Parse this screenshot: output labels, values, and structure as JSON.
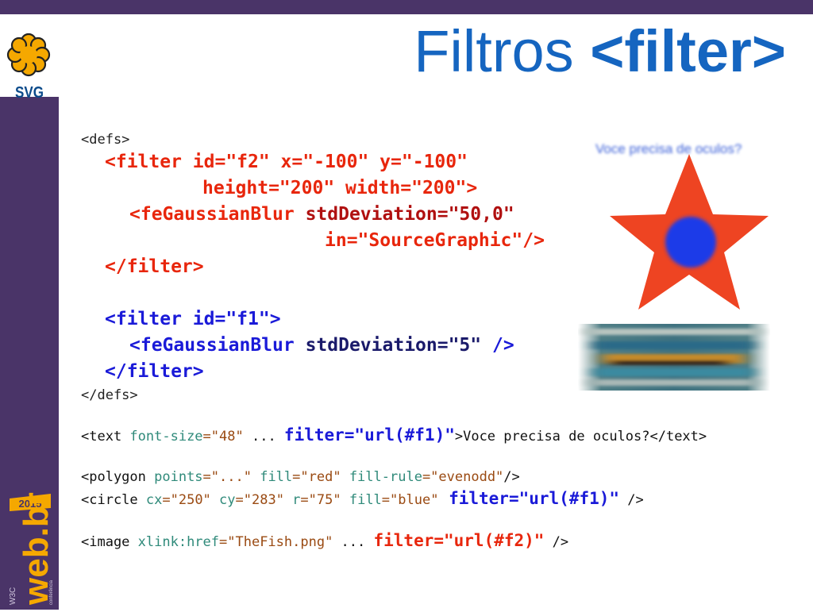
{
  "logo": {
    "icon": "svg-flower-icon",
    "text": "SVG"
  },
  "title": {
    "normal": "Filtros ",
    "bold": "<filter>"
  },
  "code": {
    "l1": "<defs>",
    "l2": "<filter id=\"f2\" x=\"-100\" y=\"-100\"",
    "l3": "height=\"200\" width=\"200\">",
    "l4a": "<feGaussianBlur",
    "l4b": " stdDeviation=\"50,0\"",
    "l5": "in=\"SourceGraphic\"/>",
    "l6": "</filter>",
    "l7a": "<filter id=\"f1\">",
    "l8a": "<feGaussianBlur",
    "l8b": " stdDeviation=\"5\"",
    "l8c": " />",
    "l9": "</filter>",
    "l10": "</defs>",
    "t1": "<text",
    "t2": " font-size",
    "t3": "=\"48\"",
    "t4": " ... ",
    "t5": "filter=\"url(#f1)\"",
    "t6": ">Voce precisa de oculos?</text>",
    "p1": "<polygon",
    "p2": " points",
    "p3": "=\"...\"",
    "p4": " fill",
    "p5": "=\"red\"",
    "p6": " fill-rule",
    "p7": "=\"evenodd\"",
    "p8": "/>",
    "c1": "<circle",
    "c2": " cx",
    "c3": "=\"250\"",
    "c4": " cy",
    "c5": "=\"283\"",
    "c6": " r",
    "c7": "=\"75\"",
    "c8": " fill",
    "c9": "=\"blue\"",
    "c10": " filter=\"url(#f1)\"",
    "c11": " />",
    "i1": "<image",
    "i2": " xlink:href",
    "i3": "=\"TheFish.png\"",
    "i4": " ... ",
    "i5": "filter=\"url(#f2)\"",
    "i6": " />"
  },
  "demo": {
    "blur_text": "Voce precisa de oculos?"
  },
  "badge": {
    "year": "2015",
    "brand": "web.br",
    "w3c": "W3C",
    "sub": "conferência"
  },
  "colors": {
    "brand_purple": "#4a3468",
    "title_blue": "#1565c0",
    "star_red": "#ee4422",
    "circle_blue": "#1a3ae8"
  }
}
